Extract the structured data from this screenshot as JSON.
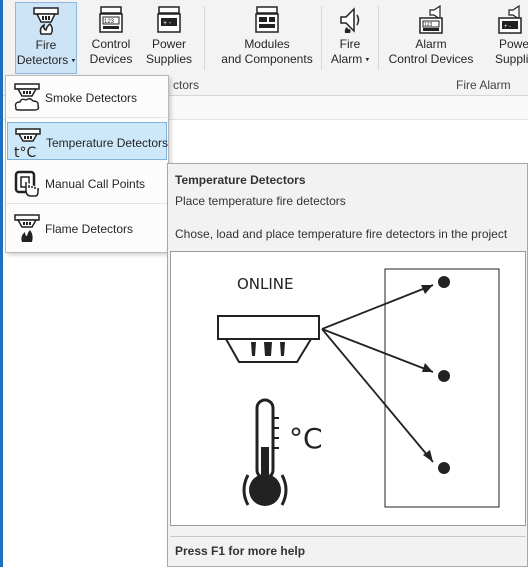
{
  "ribbon": {
    "buttons": [
      {
        "line1": "Fire",
        "line2": "Detectors"
      },
      {
        "line1": "Control",
        "line2": "Devices"
      },
      {
        "line1": "Power",
        "line2": "Supplies"
      },
      {
        "line1": "Modules",
        "line2": "and Components"
      },
      {
        "line1": "Fire",
        "line2": "Alarm"
      },
      {
        "line1": "Alarm",
        "line2": "Control Devices"
      },
      {
        "line1": "Power",
        "line2": "Supplie"
      }
    ],
    "groups": {
      "fire_detectors_partial": "ctors",
      "fire_alarm": "Fire Alarm"
    },
    "dropdown_caret": "▾"
  },
  "menu": {
    "items": [
      {
        "label": "Smoke Detectors",
        "icon": "smoke-detector-icon"
      },
      {
        "label": "Temperature Detectors",
        "icon": "temperature-detector-icon"
      },
      {
        "label": "Manual Call Points",
        "icon": "manual-call-point-icon"
      },
      {
        "label": "Flame Detectors",
        "icon": "flame-detector-icon"
      }
    ],
    "selected_index": 1
  },
  "tooltip": {
    "title": "Temperature Detectors",
    "subtitle": "Place temperature fire detectors",
    "description": "Chose, load and place temperature fire detectors in the project",
    "image": {
      "status_text": "ONLINE",
      "unit_text": "°C"
    },
    "footer": "Press F1 for more help"
  },
  "colors": {
    "accent": "#1e6fbf",
    "selected_bg": "#cde8f9",
    "tooltip_bg": "#f2f2f2"
  }
}
